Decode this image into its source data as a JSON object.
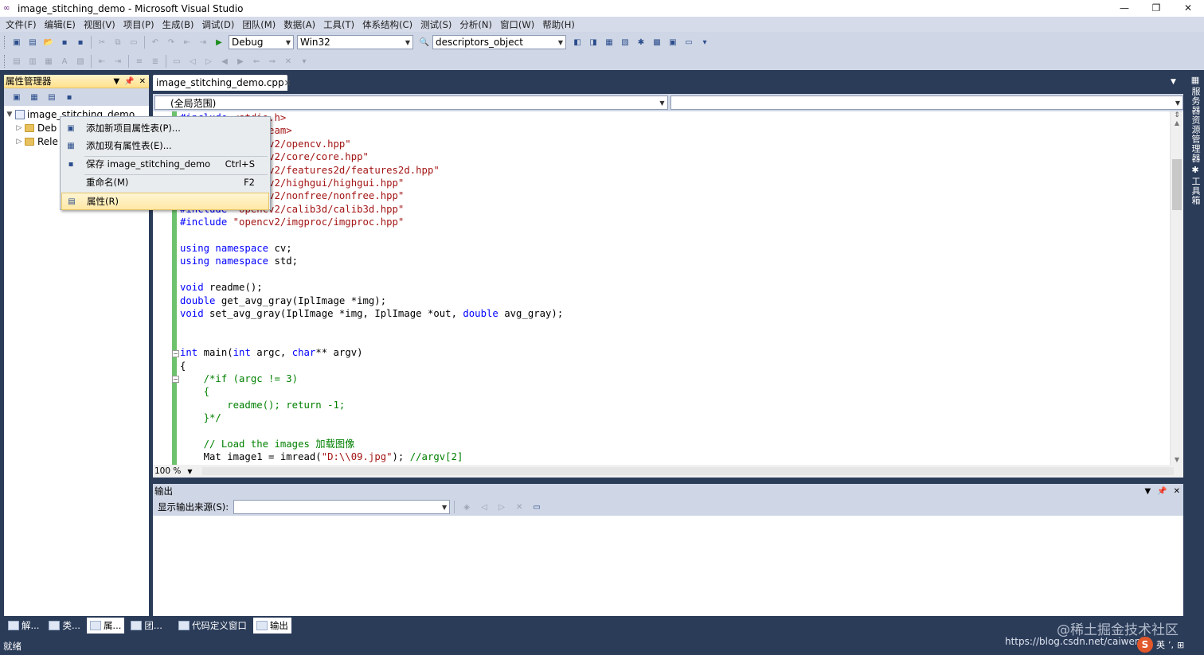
{
  "window": {
    "title": "image_stitching_demo - Microsoft Visual Studio",
    "controls": [
      "—",
      "❐",
      "✕"
    ]
  },
  "menu": [
    "文件(F)",
    "编辑(E)",
    "视图(V)",
    "项目(P)",
    "生成(B)",
    "调试(D)",
    "团队(M)",
    "数据(A)",
    "工具(T)",
    "体系结构(C)",
    "测试(S)",
    "分析(N)",
    "窗口(W)",
    "帮助(H)"
  ],
  "toolbar": {
    "config": "Debug",
    "platform": "Win32",
    "find": "descriptors_object"
  },
  "property_manager": {
    "title": "属性管理器",
    "project": "image_stitching_demo",
    "items": [
      "Debug",
      "Release"
    ],
    "items_visible": [
      "Deb",
      "Rele"
    ]
  },
  "context_menu": {
    "items": [
      {
        "label": "添加新项目属性表(P)...",
        "shortcut": ""
      },
      {
        "label": "添加现有属性表(E)...",
        "shortcut": ""
      },
      {
        "label": "保存 image_stitching_demo",
        "shortcut": "Ctrl+S"
      },
      {
        "label": "重命名(M)",
        "shortcut": "F2"
      },
      {
        "label": "属性(R)",
        "shortcut": ""
      }
    ]
  },
  "editor": {
    "tab": "image_stitching_demo.cpp",
    "scope": "(全局范围)",
    "member": "",
    "zoom": "100 %",
    "lines": [
      "#include <stdio.h>",
      "#include <iostream>",
      "#include \"opencv2/opencv.hpp\"",
      "#include \"opencv2/core/core.hpp\"",
      "#include \"opencv2/features2d/features2d.hpp\"",
      "#include \"opencv2/highgui/highgui.hpp\"",
      "#include \"opencv2/nonfree/nonfree.hpp\"",
      "#include \"opencv2/calib3d/calib3d.hpp\"",
      "#include \"opencv2/imgproc/imgproc.hpp\"",
      "",
      "using namespace cv;",
      "using namespace std;",
      "",
      "void readme();",
      "double get_avg_gray(IplImage *img);",
      "void set_avg_gray(IplImage *img, IplImage *out, double avg_gray);",
      "",
      "",
      "int main(int argc, char** argv)",
      "{",
      "    /*if (argc != 3)",
      "    {",
      "        readme(); return -1;",
      "    }*/",
      "",
      "    // Load the images 加载图像",
      "    Mat image1 = imread(\"D:\\\\09.jpg\"); //argv[2]"
    ]
  },
  "output": {
    "title": "输出",
    "source_label": "显示输出来源(S):",
    "source_value": ""
  },
  "right_strip": [
    "服务器资源管理器",
    "工具箱"
  ],
  "bottom_tabs": [
    "解...",
    "类...",
    "属...",
    "团...",
    "代码定义窗口",
    "输出"
  ],
  "status": "就绪",
  "watermark": {
    "line1": "@稀土掘金技术社区",
    "line2": "https://blog.csdn.net/caiwenbi"
  },
  "ime": {
    "logo": "S",
    "mode": "英",
    "punct": "’,",
    "grid": "⊞"
  }
}
